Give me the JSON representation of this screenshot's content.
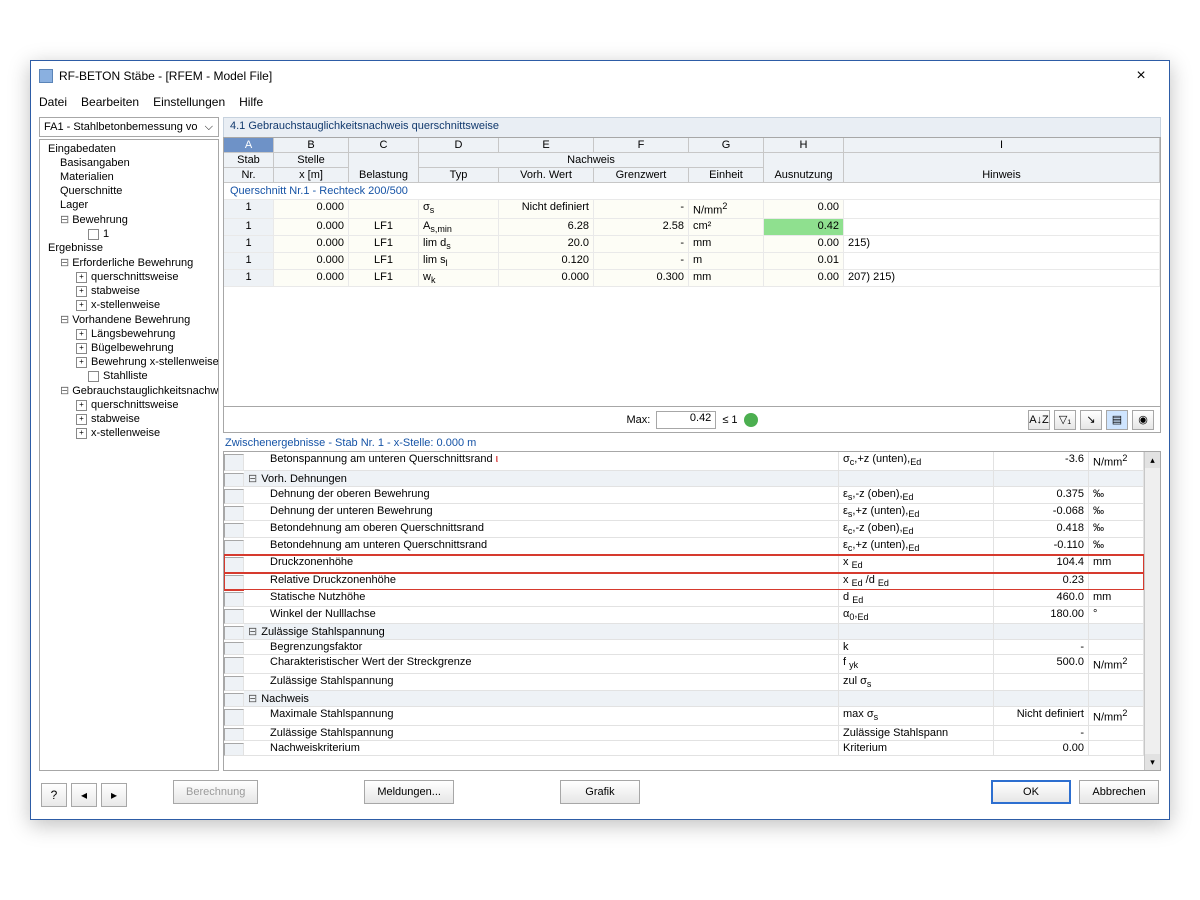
{
  "window": {
    "title": "RF-BETON Stäbe - [RFEM - Model File]"
  },
  "menu": {
    "file": "Datei",
    "edit": "Bearbeiten",
    "settings": "Einstellungen",
    "help": "Hilfe"
  },
  "combo": {
    "value": "FA1 - Stahlbetonbemessung vo"
  },
  "tree": {
    "n0": "Eingabedaten",
    "n0_0": "Basisangaben",
    "n0_1": "Materialien",
    "n0_2": "Querschnitte",
    "n0_3": "Lager",
    "n0_4": "Bewehrung",
    "n0_4_0": "1",
    "n1": "Ergebnisse",
    "n1_0": "Erforderliche Bewehrung",
    "n1_0_0": "querschnittsweise",
    "n1_0_1": "stabweise",
    "n1_0_2": "x-stellenweise",
    "n1_1": "Vorhandene Bewehrung",
    "n1_1_0": "Längsbewehrung",
    "n1_1_1": "Bügelbewehrung",
    "n1_1_2": "Bewehrung x-stellenweise",
    "n1_1_3": "Stahlliste",
    "n1_2": "Gebrauchstauglichkeitsnachwei",
    "n1_2_0": "querschnittsweise",
    "n1_2_1": "stabweise",
    "n1_2_2": "x-stellenweise"
  },
  "panel": {
    "title": "4.1 Gebrauchstauglichkeitsnachweis querschnittsweise"
  },
  "cols": {
    "A": "A",
    "B": "B",
    "C": "C",
    "D": "D",
    "E": "E",
    "F": "F",
    "G": "G",
    "H": "H",
    "I": "I",
    "stab": "Stab",
    "nr": "Nr.",
    "stelle": "Stelle",
    "xm": "x [m]",
    "belast": "Belastung",
    "nachweis": "Nachweis",
    "typ": "Typ",
    "vorh": "Vorh. Wert",
    "grenz": "Grenzwert",
    "einheit": "Einheit",
    "ausn": "Ausnutzung",
    "hinw": "Hinweis"
  },
  "sectionLabel": "Querschnitt Nr.1  -  Rechteck 200/500",
  "rows": [
    {
      "nr": "1",
      "x": "0.000",
      "bel": "",
      "typ": "σs",
      "vorh": "Nicht definiert",
      "grenz": "-",
      "ein": "N/mm²",
      "ausn": "0.00",
      "hin": "",
      "green": false
    },
    {
      "nr": "1",
      "x": "0.000",
      "bel": "LF1",
      "typ": "As,min",
      "vorh": "6.28",
      "grenz": "2.58",
      "ein": "cm²",
      "ausn": "0.42",
      "hin": "",
      "green": true
    },
    {
      "nr": "1",
      "x": "0.000",
      "bel": "LF1",
      "typ": "lim ds",
      "vorh": "20.0",
      "grenz": "-",
      "ein": "mm",
      "ausn": "0.00",
      "hin": "215)",
      "green": false
    },
    {
      "nr": "1",
      "x": "0.000",
      "bel": "LF1",
      "typ": "lim sl",
      "vorh": "0.120",
      "grenz": "-",
      "ein": "m",
      "ausn": "0.01",
      "hin": "",
      "green": false
    },
    {
      "nr": "1",
      "x": "0.000",
      "bel": "LF1",
      "typ": "wk",
      "vorh": "0.000",
      "grenz": "0.300",
      "ein": "mm",
      "ausn": "0.00",
      "hin": "207) 215)",
      "green": false
    }
  ],
  "maxbar": {
    "label": "Max:",
    "value": "0.42",
    "le": "≤ 1"
  },
  "midlabel": "Zwischenergebnisse -  Stab Nr. 1  -  x-Stelle: 0.000 m",
  "detail": [
    {
      "type": "row",
      "label": "Betonspannung am unteren Querschnittsrand",
      "sym": "σc,+z (unten),Ed",
      "val": "-3.6",
      "unit": "N/mm²",
      "indent": 1,
      "redmark": true
    },
    {
      "type": "group",
      "label": "Vorh. Dehnungen"
    },
    {
      "type": "row",
      "label": "Dehnung der oberen Bewehrung",
      "sym": "εs,-z (oben),Ed",
      "val": "0.375",
      "unit": "‰",
      "indent": 1
    },
    {
      "type": "row",
      "label": "Dehnung der unteren Bewehrung",
      "sym": "εs,+z (unten),Ed",
      "val": "-0.068",
      "unit": "‰",
      "indent": 1
    },
    {
      "type": "row",
      "label": "Betondehnung am oberen Querschnittsrand",
      "sym": "εc,-z (oben),Ed",
      "val": "0.418",
      "unit": "‰",
      "indent": 1
    },
    {
      "type": "row",
      "label": "Betondehnung am unteren Querschnittsrand",
      "sym": "εc,+z (unten),Ed",
      "val": "-0.110",
      "unit": "‰",
      "indent": 1
    },
    {
      "type": "row",
      "label": "Druckzonenhöhe",
      "sym": "x Ed",
      "val": "104.4",
      "unit": "mm",
      "indent": 1,
      "red": true
    },
    {
      "type": "row",
      "label": "Relative Druckzonenhöhe",
      "sym": "x Ed /d Ed",
      "val": "0.23",
      "unit": "",
      "indent": 1,
      "red": true
    },
    {
      "type": "row",
      "label": "Statische Nutzhöhe",
      "sym": "d Ed",
      "val": "460.0",
      "unit": "mm",
      "indent": 1
    },
    {
      "type": "row",
      "label": "Winkel der Nulllachse",
      "sym": "α0,Ed",
      "val": "180.00",
      "unit": "°",
      "indent": 1
    },
    {
      "type": "group",
      "label": "Zulässige Stahlspannung"
    },
    {
      "type": "row",
      "label": "Begrenzungsfaktor",
      "sym": "k",
      "val": "-",
      "unit": "",
      "indent": 1
    },
    {
      "type": "row",
      "label": "Charakteristischer Wert der Streckgrenze",
      "sym": "f yk",
      "val": "500.0",
      "unit": "N/mm²",
      "indent": 1
    },
    {
      "type": "row",
      "label": "Zulässige Stahlspannung",
      "sym": "zul σs",
      "val": "",
      "unit": "",
      "indent": 1
    },
    {
      "type": "group",
      "label": "Nachweis"
    },
    {
      "type": "row",
      "label": "Maximale Stahlspannung",
      "sym": "max σs",
      "val": "Nicht definiert",
      "unit": "N/mm²",
      "indent": 1
    },
    {
      "type": "row",
      "label": "Zulässige Stahlspannung",
      "sym": "Zulässige Stahlspann",
      "val": "-",
      "unit": "",
      "indent": 1
    },
    {
      "type": "row",
      "label": "Nachweiskriterium",
      "sym": "Kriterium",
      "val": "0.00",
      "unit": "",
      "indent": 1
    }
  ],
  "buttons": {
    "calc": "Berechnung",
    "msg": "Meldungen...",
    "gfx": "Grafik",
    "ok": "OK",
    "cancel": "Abbrechen"
  },
  "icons": {
    "sort": "A↓Z",
    "filter": "▽₁",
    "pick": "↘",
    "bar": "▤",
    "eye": "◉"
  }
}
